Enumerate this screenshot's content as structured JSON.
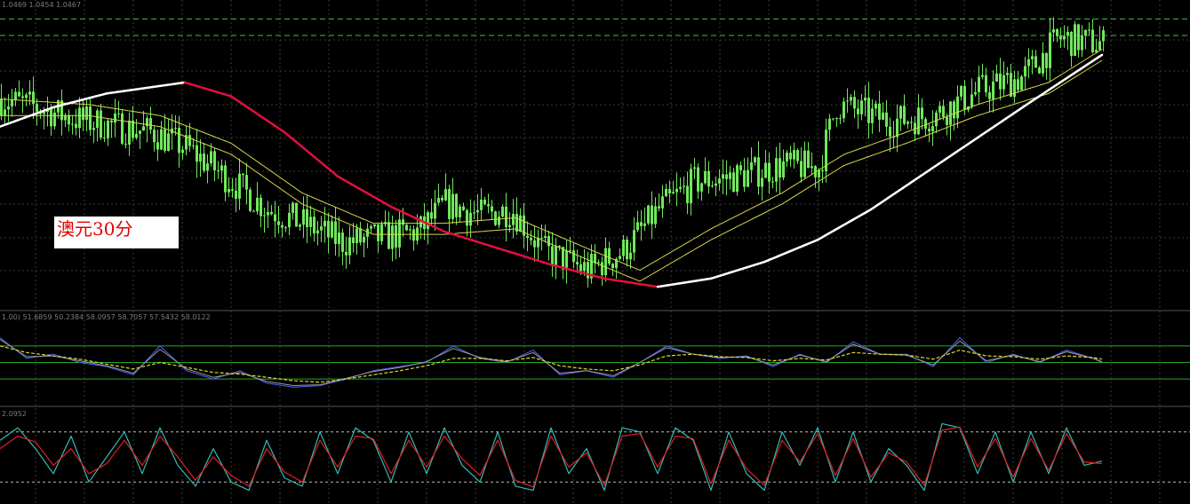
{
  "chart_label": "澳元30分",
  "main_panel": {
    "header": "1.0469 1.0454 1.0467",
    "dashed_levels": [
      1.0469,
      1.0463
    ]
  },
  "oscillator_panel": {
    "header": "1.00) 51.6859 50.2384 58.0957 58.7057 57.5432 58.0122",
    "levels": [
      70,
      50,
      30
    ]
  },
  "stochastic_panel": {
    "header": "2.0952"
  },
  "colors": {
    "background": "#000000",
    "grid": "#3a3a3a",
    "candle": "#6fe85a",
    "ma_rising": "#ffffff",
    "ma_falling": "#e0103c",
    "envelope": "#d8d84a",
    "level_line": "#27a827",
    "dashed_level": "#3ec13e",
    "osc_blue": "#5060ff",
    "osc_grey": "#9a9a9a",
    "osc_signal": "#d8d830",
    "stoch_main": "#37b9b9",
    "stoch_signal": "#e02020",
    "label_box": "#ffffff",
    "label_text": "#e00000"
  },
  "chart_data": [
    {
      "type": "candlestick",
      "title": "澳元30分",
      "price_path": {
        "x": [
          0,
          40,
          80,
          130,
          170,
          210,
          260,
          300,
          340,
          385,
          430,
          470,
          500,
          540,
          575,
          610,
          660,
          700,
          740,
          780,
          830,
          880,
          920,
          940,
          1000,
          1050,
          1100,
          1150,
          1190,
          1240
        ],
        "y": [
          1.044,
          1.0437,
          1.0433,
          1.043,
          1.0428,
          1.0422,
          1.041,
          1.04,
          1.0395,
          1.0388,
          1.039,
          1.0392,
          1.0402,
          1.0398,
          1.04,
          1.0385,
          1.0378,
          1.0385,
          1.04,
          1.041,
          1.0412,
          1.0416,
          1.0415,
          1.0438,
          1.0432,
          1.0434,
          1.0443,
          1.0448,
          1.0462,
          1.046
        ]
      },
      "moving_average": {
        "x": [
          0,
          60,
          120,
          208,
          260,
          320,
          380,
          440,
          500,
          560,
          620,
          680,
          740,
          800,
          860,
          920,
          980,
          1040,
          1100,
          1160,
          1240
        ],
        "y": [
          1.043,
          1.0437,
          1.0442,
          1.0446,
          1.0441,
          1.0428,
          1.0412,
          1.0401,
          1.0392,
          1.0386,
          1.038,
          1.0375,
          1.0372,
          1.0375,
          1.0381,
          1.0389,
          1.04,
          1.0413,
          1.0426,
          1.0439,
          1.0456
        ]
      },
      "envelope_upper": {
        "x": [
          0,
          100,
          180,
          260,
          340,
          420,
          500,
          580,
          660,
          720,
          800,
          880,
          950,
          1020,
          1100,
          1180,
          1240
        ],
        "y": [
          1.044,
          1.0438,
          1.0434,
          1.0424,
          1.0406,
          1.0395,
          1.0395,
          1.0397,
          1.0386,
          1.0378,
          1.0393,
          1.0406,
          1.042,
          1.0428,
          1.0438,
          1.0446,
          1.0458
        ]
      },
      "envelope_lower": {
        "x": [
          0,
          100,
          180,
          260,
          340,
          420,
          500,
          580,
          660,
          720,
          800,
          880,
          950,
          1020,
          1100,
          1180,
          1240
        ],
        "y": [
          1.0434,
          1.0434,
          1.043,
          1.042,
          1.0402,
          1.0391,
          1.0391,
          1.0393,
          1.0382,
          1.0374,
          1.0389,
          1.0402,
          1.0416,
          1.0424,
          1.0434,
          1.0442,
          1.0454
        ]
      },
      "ylim": [
        1.0365,
        1.0472
      ]
    },
    {
      "type": "line",
      "ylim": [
        0,
        100
      ],
      "levels": [
        70,
        50,
        30
      ],
      "x": [
        0,
        30,
        60,
        90,
        120,
        150,
        180,
        210,
        240,
        270,
        300,
        330,
        360,
        390,
        420,
        450,
        480,
        510,
        540,
        570,
        600,
        630,
        660,
        690,
        720,
        750,
        780,
        810,
        840,
        870,
        900,
        930,
        960,
        990,
        1020,
        1050,
        1080,
        1110,
        1140,
        1170,
        1200,
        1230,
        1240
      ],
      "series": [
        {
          "values": [
            80,
            55,
            60,
            50,
            45,
            35,
            70,
            40,
            30,
            40,
            25,
            20,
            22,
            30,
            40,
            45,
            50,
            70,
            55,
            50,
            65,
            35,
            40,
            32,
            50,
            70,
            60,
            55,
            58,
            45,
            60,
            50,
            75,
            60,
            60,
            45,
            80,
            50,
            60,
            50,
            65,
            55,
            50
          ]
        },
        {
          "values": [
            78,
            57,
            58,
            52,
            46,
            37,
            66,
            42,
            32,
            38,
            27,
            22,
            23,
            31,
            39,
            44,
            51,
            67,
            56,
            51,
            62,
            37,
            40,
            34,
            50,
            68,
            60,
            56,
            57,
            47,
            59,
            51,
            72,
            60,
            59,
            47,
            76,
            52,
            59,
            51,
            63,
            55,
            51
          ]
        },
        {
          "values": [
            70,
            62,
            58,
            54,
            48,
            42,
            50,
            44,
            38,
            36,
            32,
            28,
            26,
            30,
            35,
            40,
            46,
            55,
            55,
            52,
            56,
            46,
            42,
            40,
            47,
            58,
            60,
            57,
            56,
            52,
            55,
            53,
            62,
            60,
            59,
            54,
            65,
            58,
            57,
            54,
            58,
            56,
            54
          ]
        }
      ]
    },
    {
      "type": "line",
      "ylim": [
        0,
        100
      ],
      "levels": [
        80,
        20
      ],
      "x": [
        0,
        20,
        40,
        60,
        80,
        100,
        120,
        140,
        160,
        180,
        200,
        220,
        240,
        260,
        280,
        300,
        320,
        340,
        360,
        380,
        400,
        420,
        440,
        460,
        480,
        500,
        520,
        540,
        560,
        580,
        600,
        620,
        640,
        660,
        680,
        700,
        720,
        740,
        760,
        780,
        800,
        820,
        840,
        860,
        880,
        900,
        920,
        940,
        960,
        980,
        1000,
        1020,
        1040,
        1060,
        1080,
        1100,
        1120,
        1140,
        1160,
        1180,
        1200,
        1220,
        1240
      ],
      "series": [
        {
          "values": [
            70,
            85,
            60,
            30,
            75,
            20,
            50,
            80,
            30,
            85,
            40,
            15,
            60,
            20,
            10,
            70,
            25,
            15,
            80,
            30,
            85,
            70,
            20,
            80,
            30,
            85,
            40,
            20,
            80,
            15,
            10,
            85,
            30,
            60,
            10,
            85,
            80,
            30,
            85,
            70,
            10,
            80,
            30,
            10,
            80,
            40,
            85,
            20,
            80,
            20,
            60,
            40,
            10,
            90,
            85,
            30,
            80,
            20,
            80,
            30,
            85,
            40,
            45
          ]
        },
        {
          "values": [
            60,
            75,
            68,
            40,
            60,
            30,
            42,
            70,
            40,
            75,
            50,
            22,
            50,
            28,
            15,
            60,
            32,
            20,
            70,
            38,
            75,
            72,
            30,
            70,
            38,
            75,
            48,
            28,
            70,
            22,
            14,
            75,
            38,
            55,
            16,
            75,
            78,
            38,
            75,
            72,
            18,
            70,
            36,
            16,
            70,
            44,
            78,
            28,
            72,
            26,
            55,
            44,
            16,
            82,
            86,
            38,
            72,
            26,
            72,
            34,
            78,
            44,
            42
          ]
        }
      ]
    }
  ]
}
